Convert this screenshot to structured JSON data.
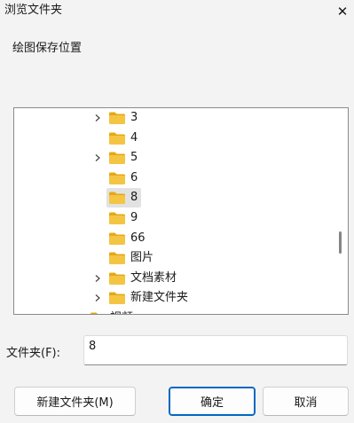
{
  "window": {
    "title": "浏览文件夹",
    "close_glyph": "✕"
  },
  "description": "绘图保存位置",
  "tree": {
    "items": [
      {
        "label": "3",
        "has_children": true,
        "selected": false
      },
      {
        "label": "4",
        "has_children": false,
        "selected": false
      },
      {
        "label": "5",
        "has_children": true,
        "selected": false
      },
      {
        "label": "6",
        "has_children": false,
        "selected": false
      },
      {
        "label": "8",
        "has_children": false,
        "selected": true
      },
      {
        "label": "9",
        "has_children": false,
        "selected": false
      },
      {
        "label": "66",
        "has_children": false,
        "selected": false
      },
      {
        "label": "图片",
        "has_children": false,
        "selected": false
      },
      {
        "label": "文档素材",
        "has_children": true,
        "selected": false
      },
      {
        "label": "新建文件夹",
        "has_children": true,
        "selected": false
      },
      {
        "label": "视频",
        "has_children": true,
        "selected": false
      }
    ]
  },
  "folder_field": {
    "label": "文件夹(F):",
    "value": "8"
  },
  "buttons": {
    "new_folder": "新建文件夹(M)",
    "ok": "确定",
    "cancel": "取消"
  },
  "colors": {
    "folder_body": "#f4c542",
    "folder_tab": "#e6a817",
    "selection": "#e2e2e2",
    "accent": "#0067c0"
  }
}
